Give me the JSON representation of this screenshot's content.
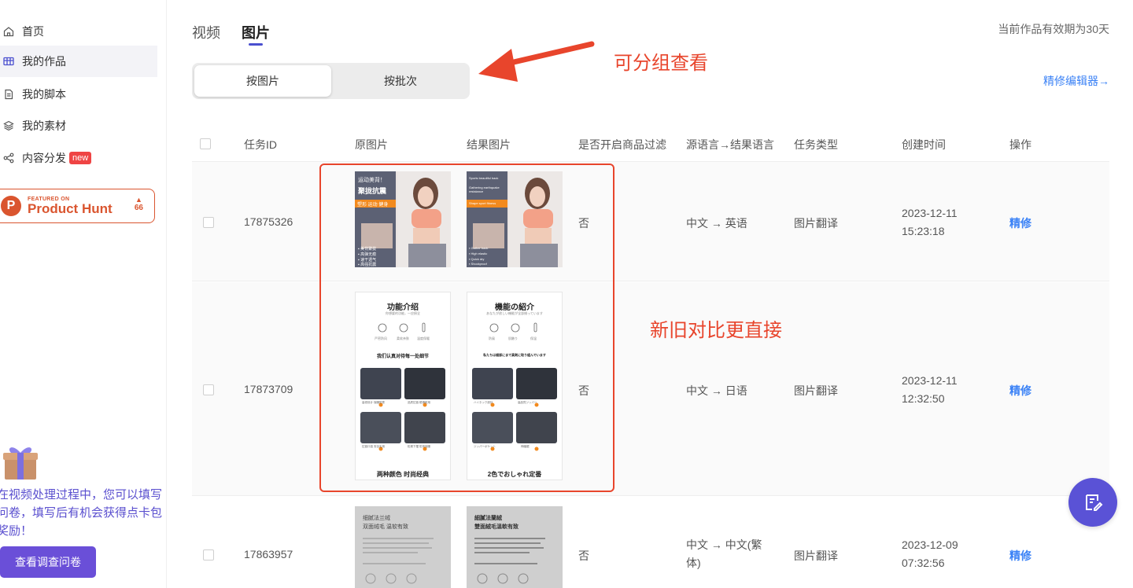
{
  "sidebar": {
    "items": [
      {
        "label": "首页",
        "icon": "home-icon"
      },
      {
        "label": "我的作品",
        "icon": "works-icon"
      },
      {
        "label": "我的脚本",
        "icon": "script-icon"
      },
      {
        "label": "我的素材",
        "icon": "layers-icon"
      },
      {
        "label": "内容分发",
        "icon": "share-icon",
        "badge": "new"
      }
    ],
    "product_hunt": {
      "featured": "FEATURED ON",
      "name": "Product Hunt",
      "votes": "66"
    },
    "promo_text": "在视频处理过程中，您可以填写问卷，填写后有机会获得点卡包奖励！",
    "survey_button": "查看调查问卷"
  },
  "tabs": [
    "视频",
    "图片"
  ],
  "validity_notice": "当前作品有效期为30天",
  "segment": {
    "by_image": "按图片",
    "by_batch": "按批次"
  },
  "annotations": {
    "group_view": "可分组查看",
    "compare": "新旧对比更直接"
  },
  "editor_link": "精修编辑器→",
  "table": {
    "headers": [
      "任务ID",
      "原图片",
      "结果图片",
      "是否开启商品过滤",
      "源语言→结果语言",
      "任务类型",
      "创建时间",
      "操作"
    ],
    "rows": [
      {
        "id": "17875326",
        "filter": "否",
        "lang": "中文 → 英语",
        "type": "图片翻译",
        "time": "2023-12-11 15:23:18",
        "action": "精修",
        "orig_text": {
          "t1": "运动美背！",
          "t2": "聚拢抗震",
          "t3": "塑形 运动 健身",
          "b1": "▪ 美背聚拢",
          "b2": "▪ 高弹无痕",
          "b3": "▪ 速干透气",
          "b4": "▪ 高强抗震"
        },
        "res_text": {
          "t1": "Sports beautiful back",
          "t2": "Gathering earthquake resistance",
          "t3": "Shape sport fitness",
          "b1": "▪ Gather back",
          "b2": "▪ High elastic",
          "b3": "▪ Quick dry",
          "b4": "▪ Shockproof"
        }
      },
      {
        "id": "17873709",
        "filter": "否",
        "lang": "中文 → 日语",
        "type": "图片翻译",
        "time": "2023-12-11 12:32:50",
        "action": "精修",
        "orig_text": {
          "title": "功能介绍",
          "sub": "你想要的功能，一应俱全",
          "i1": "严密防风",
          "i2": "柔软亲肤",
          "i3": "温度保暖",
          "mid": "我们认真对待每一处细节",
          "c1": "高领设计 保暖防寒",
          "c2": "品质拉链 顺滑耐用",
          "c3": "拉链口袋 安全实用",
          "c4": "松紧下摆 防风保暖",
          "bottom": "两种颜色 时尚经典"
        },
        "res_text": {
          "title": "機能の紹介",
          "sub": "あなたが欲しい機能が全部揃っています",
          "i1": "防風",
          "i2": "肌触り",
          "i3": "保温",
          "mid": "私たちは細部にまで真剣に取り組んでいます",
          "c1": "ハイネック設計",
          "c2": "高品質ジッパー",
          "c3": "ジッパーポケット",
          "c4": "伸縮裾",
          "bottom": "2色でおしゃれ定番"
        }
      },
      {
        "id": "17863957",
        "filter": "否",
        "lang": "中文 → 中文(繁体)",
        "type": "图片翻译",
        "time": "2023-12-09 07:32:56",
        "action": "精修",
        "orig_text": {
          "t1": "细腻法兰绒",
          "t2": "双面绒毛 温软有致"
        },
        "res_text": {
          "t1": "細膩法蘭絨",
          "t2": "雙面絨毛溫軟有致"
        }
      }
    ]
  },
  "colors": {
    "accent": "#4a4fcf",
    "annotation": "#e8452c",
    "link": "#3b82f6",
    "survey": "#6a4fd8"
  }
}
